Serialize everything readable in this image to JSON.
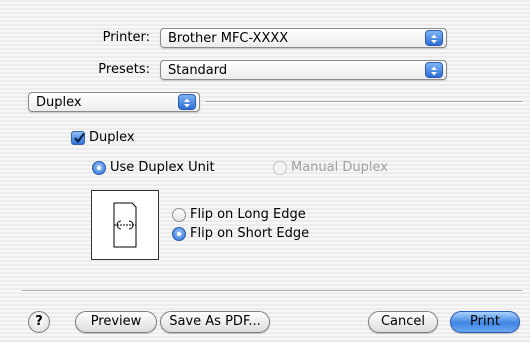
{
  "printer": {
    "label": "Printer:",
    "value": "Brother MFC-XXXX"
  },
  "presets": {
    "label": "Presets:",
    "value": "Standard"
  },
  "panel_select": {
    "value": "Duplex"
  },
  "duplex": {
    "checkbox_label": "Duplex",
    "checked": true,
    "use_unit_label": "Use Duplex Unit",
    "manual_label": "Manual Duplex",
    "flip_long_label": "Flip on Long Edge",
    "flip_short_label": "Flip on Short Edge",
    "selected_flip": "short"
  },
  "buttons": {
    "help": "?",
    "preview": "Preview",
    "save_pdf": "Save As PDF...",
    "cancel": "Cancel",
    "print": "Print"
  },
  "colors": {
    "accent": "#2f74d8",
    "disabled_text": "#a0a0a0"
  }
}
